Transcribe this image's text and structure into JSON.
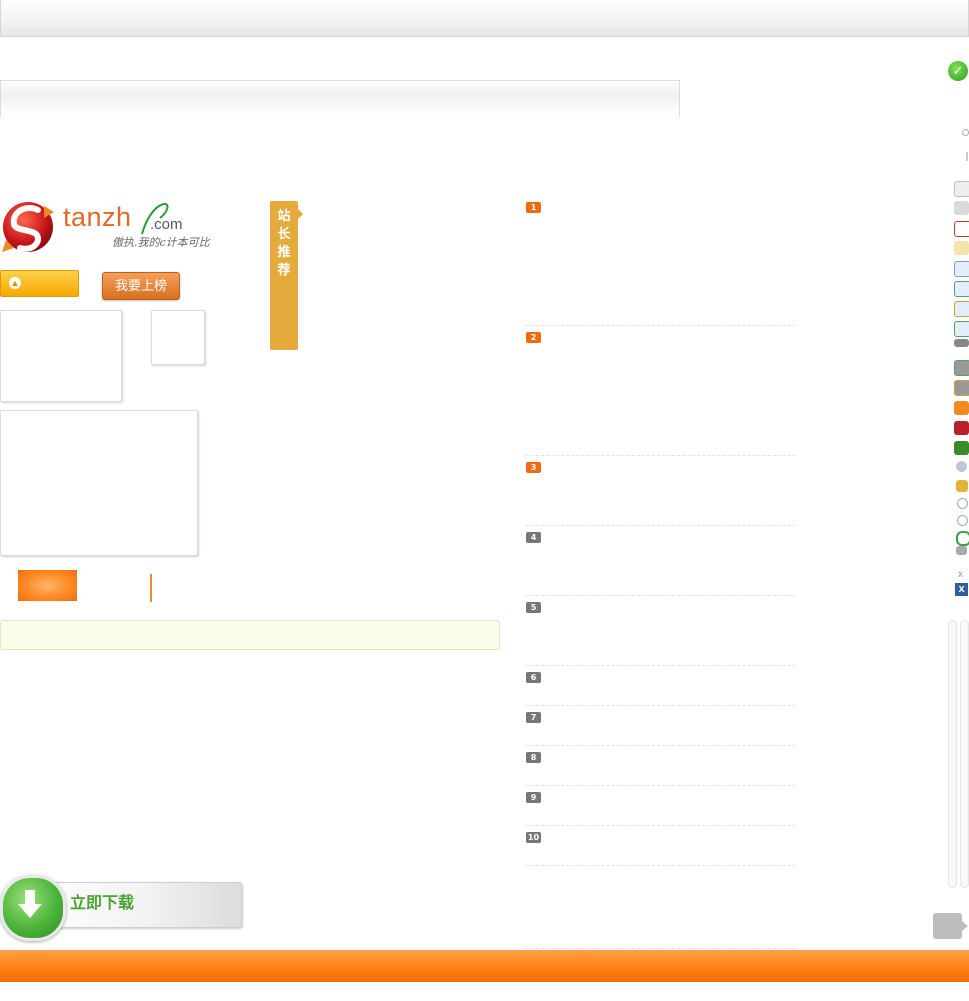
{
  "logo": {
    "word": "tanzh",
    "domain": ".com",
    "signature": "傲执.我的c计本可比"
  },
  "buttons": {
    "rank_label": "我要上榜"
  },
  "recommend": {
    "chars": [
      "站",
      "长",
      "推",
      "荐"
    ]
  },
  "ranking": {
    "numbers": [
      "1",
      "2",
      "3",
      "4",
      "5",
      "6",
      "7",
      "8",
      "9",
      "10"
    ]
  },
  "download": {
    "label": "立即下载"
  },
  "colors": {
    "accent": "#ff7d12",
    "badge_hot": "#f06a14",
    "badge_normal": "#777777",
    "ribbon": "#e4aa3c",
    "download_green": "#4aa233"
  },
  "toolbar": {
    "icons": [
      "home-icon",
      "tag-icon",
      "calendar-icon",
      "edit-icon",
      "comment-icon",
      "comment-add-icon",
      "comment-edit-icon",
      "comment-delete-icon",
      "link-icon",
      "link-add-icon",
      "link-edit-icon",
      "rss-icon",
      "thumb-down-icon",
      "thumb-up-icon",
      "collapse-icon",
      "pencil-icon",
      "close-circle-icon",
      "add-circle-icon",
      "undo-icon",
      "tool-icon",
      "small-close-icon",
      "close-box-icon"
    ]
  }
}
